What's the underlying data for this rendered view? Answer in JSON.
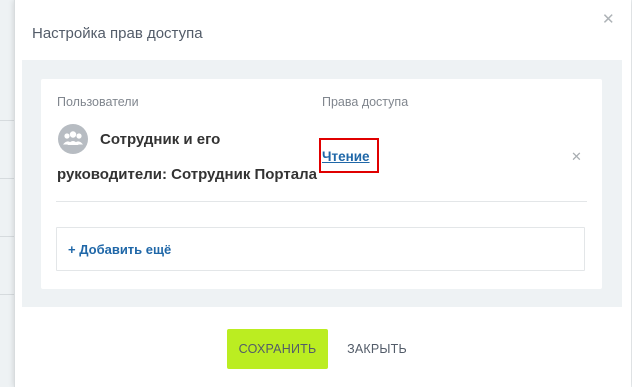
{
  "dialog": {
    "title": "Настройка прав доступа",
    "close_icon": "close-icon"
  },
  "table": {
    "headers": {
      "users": "Пользователи",
      "rights": "Права доступа"
    },
    "rows": [
      {
        "avatar_icon": "group-users-icon",
        "name_line1": "Сотрудник и его",
        "name_line2": "руководители: Сотрудник Портала",
        "access": "Чтение",
        "remove_icon": "remove-icon"
      }
    ],
    "add_more": "+ Добавить ещё"
  },
  "footer": {
    "save_label": "СОХРАНИТЬ",
    "close_label": "ЗАКРЫТЬ"
  },
  "colors": {
    "save_button": "#bbed21",
    "link": "#1f67a8",
    "highlight": "#e00000"
  }
}
